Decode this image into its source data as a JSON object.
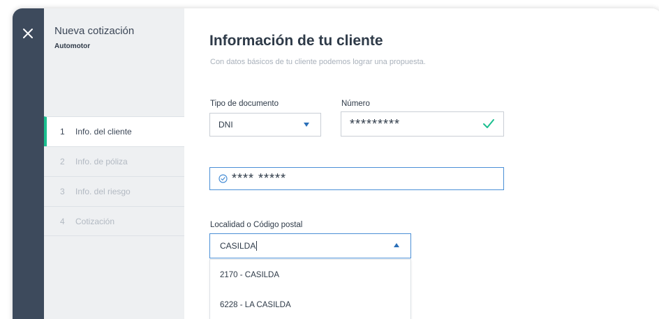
{
  "sidebar": {
    "title": "Nueva cotización",
    "subtitle": "Automotor",
    "steps": [
      {
        "num": "1",
        "label": "Info. del cliente",
        "active": true
      },
      {
        "num": "2",
        "label": "Info. de póliza",
        "active": false
      },
      {
        "num": "3",
        "label": "Info. del riesgo",
        "active": false
      },
      {
        "num": "4",
        "label": "Cotización",
        "active": false
      }
    ]
  },
  "main": {
    "title": "Información de tu cliente",
    "subtitle": "Con datos básicos de tu cliente podemos lograr una propuesta.",
    "doc_type": {
      "label": "Tipo de documento",
      "value": "DNI"
    },
    "doc_number": {
      "label": "Número",
      "value": "*********"
    },
    "client_name": {
      "value": "**** *****"
    },
    "locality": {
      "label": "Localidad o Código postal",
      "value": "CASILDA",
      "options": [
        "2170 - CASILDA",
        "6228 - LA CASILDA"
      ]
    }
  },
  "colors": {
    "rail": "#3d4a5c",
    "sidebar": "#eef0f2",
    "accent_green": "#1bbf8f",
    "focus_blue": "#4a8fd6",
    "caret_blue": "#2a6fb8"
  },
  "icons": {
    "close": "close-icon",
    "check": "check-icon",
    "verified": "check-circle-icon",
    "caret": "caret-icon"
  }
}
